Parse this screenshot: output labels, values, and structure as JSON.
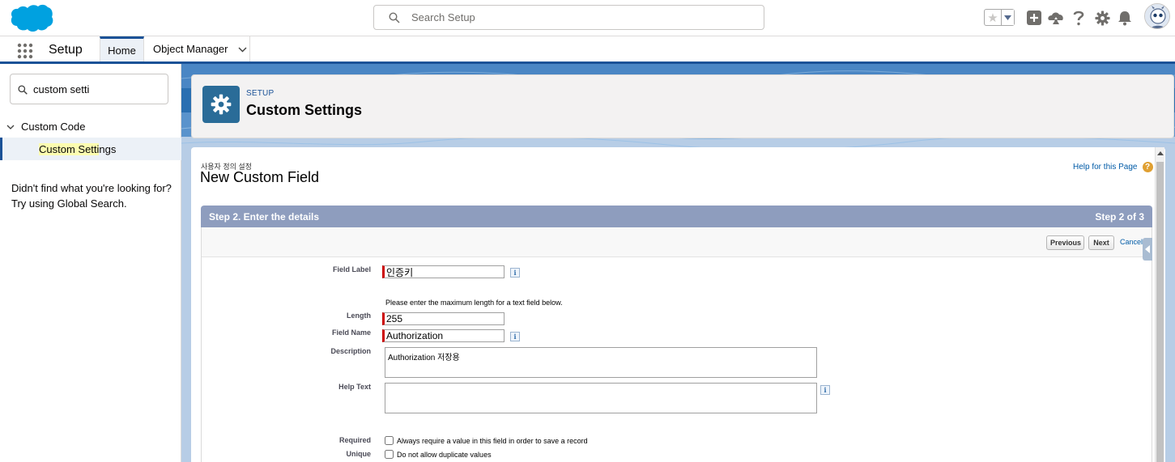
{
  "global_header": {
    "search_placeholder": "Search Setup",
    "icons": [
      "salesforce-cloud-logo",
      "search-icon",
      "star-icon",
      "chevron-down-icon",
      "add-icon",
      "trailhead-icon",
      "help-icon",
      "gear-icon",
      "bell-icon",
      "avatar"
    ]
  },
  "context_bar": {
    "app_name": "Setup",
    "tabs": [
      {
        "label": "Home",
        "active": true
      },
      {
        "label": "Object Manager",
        "active": false
      }
    ]
  },
  "sidebar": {
    "quick_find_value": "custom setti",
    "tree": {
      "parent_label": "Custom Code",
      "child_label_highlight": "Custom Setti",
      "child_label_rest": "ngs"
    },
    "not_found_line1": "Didn't find what you're looking for?",
    "not_found_line2": "Try using Global Search."
  },
  "page_header": {
    "eyebrow": "SETUP",
    "title": "Custom Settings"
  },
  "content": {
    "breadcrumb": "사용자 정의 설정",
    "title": "New Custom Field",
    "help_link": "Help for this Page",
    "step_title": "Step 2. Enter the details",
    "step_counter": "Step 2 of 3",
    "buttons": {
      "previous": "Previous",
      "next": "Next",
      "cancel": "Cancel"
    },
    "fields": {
      "field_label": {
        "label": "Field Label",
        "value": "인증키"
      },
      "length_hint": "Please enter the maximum length for a text field below.",
      "length": {
        "label": "Length",
        "value": "255"
      },
      "field_name": {
        "label": "Field Name",
        "value": "Authorization"
      },
      "description": {
        "label": "Description",
        "value": "Authorization 저장용"
      },
      "help_text": {
        "label": "Help Text",
        "value": ""
      },
      "required": {
        "label": "Required",
        "text": "Always require a value in this field in order to save a record",
        "checked": false
      },
      "unique": {
        "label": "Unique",
        "text": "Do not allow duplicate values",
        "checked": false
      }
    },
    "info_glyph": "i"
  },
  "colors": {
    "brand_blue": "#1b5297",
    "salesforce_cloud": "#00a1e0",
    "header_icon_bg": "#2a6c98",
    "step_header_bg": "#8e9dbe",
    "required_bar": "#cc0000",
    "link": "#015ba7"
  }
}
